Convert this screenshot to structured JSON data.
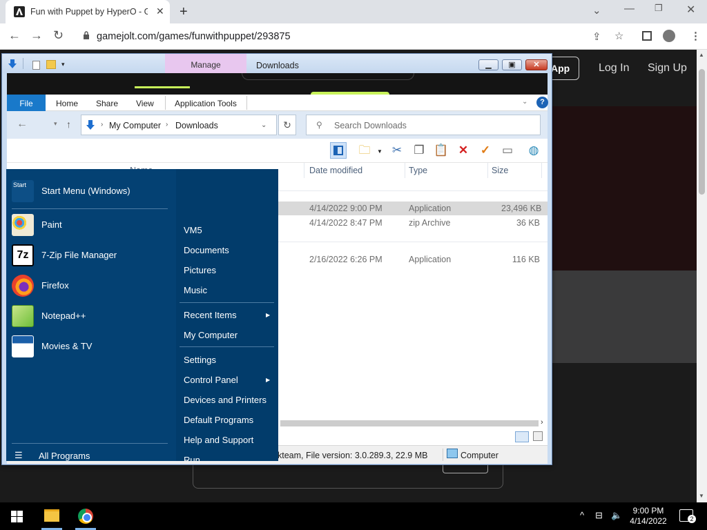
{
  "browser": {
    "tab_title": "Fun with Puppet by HyperO - Ga",
    "url": "gamejolt.com/games/funwithpuppet/293875"
  },
  "website": {
    "app_label": "App",
    "login_label": "Log In",
    "signup_label": "Sign Up"
  },
  "explorer": {
    "manage_tab": "Manage",
    "title": "Downloads",
    "ribbon_tabs": [
      "File",
      "Home",
      "Share",
      "View",
      "Application Tools"
    ],
    "breadcrumb": [
      "My Computer",
      "Downloads"
    ],
    "search_placeholder": "Search Downloads",
    "columns": {
      "name": "Name",
      "date": "Date modified",
      "type": "Type",
      "size": "Size"
    },
    "files": [
      {
        "date": "4/14/2022 9:00 PM",
        "type": "Application",
        "size": "23,496 KB",
        "selected": true
      },
      {
        "date": "4/14/2022 8:47 PM",
        "type": "zip Archive",
        "size": "36 KB",
        "selected": false
      },
      {
        "date": "2/16/2022 6:26 PM",
        "type": "Application",
        "size": "116 KB",
        "selected": false
      }
    ],
    "status_text": "kteam, File version: 3.0.289.3, 22.9 MB",
    "status_computer": "Computer"
  },
  "start_menu": {
    "pinned": [
      {
        "label": "Start Menu (Windows)",
        "icon": "start-menu-icon"
      },
      {
        "label": "Paint",
        "icon": "paint-icon"
      },
      {
        "label": "7-Zip File Manager",
        "icon": "7zip-icon"
      },
      {
        "label": "Firefox",
        "icon": "firefox-icon"
      },
      {
        "label": "Notepad++",
        "icon": "notepadpp-icon"
      },
      {
        "label": "Movies & TV",
        "icon": "movies-tv-icon"
      }
    ],
    "start_icon_text": "Start",
    "sevenzip_icon_text": "7z",
    "all_programs": "All Programs",
    "right_items": {
      "vm5": "VM5",
      "documents": "Documents",
      "pictures": "Pictures",
      "music": "Music",
      "recent_items": "Recent Items",
      "my_computer": "My Computer",
      "settings": "Settings",
      "control_panel": "Control Panel",
      "devices_printers": "Devices and Printers",
      "default_programs": "Default Programs",
      "help_support": "Help and Support",
      "run": "Run..."
    }
  },
  "taskbar": {
    "time": "9:00 PM",
    "date": "4/14/2022",
    "notification_count": "2"
  },
  "colors": {
    "start_menu_bg": "#044173",
    "ribbon_file": "#1979ca",
    "manage_tab": "#e8c7ef",
    "accent_green": "#c8f25a"
  }
}
